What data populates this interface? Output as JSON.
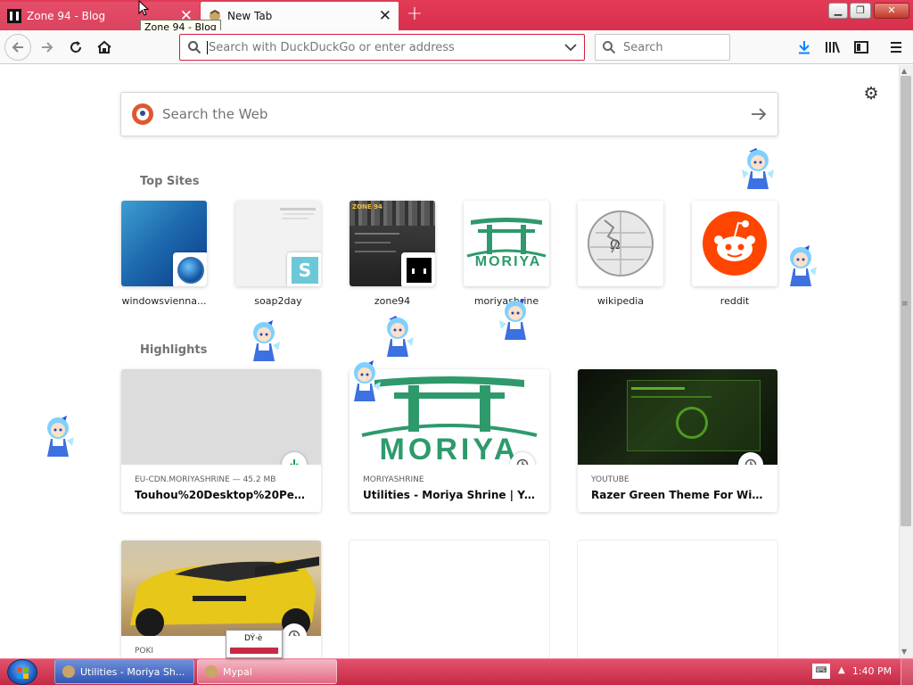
{
  "tabs": [
    {
      "title": "Zone 94 - Blog",
      "active": false
    },
    {
      "title": "New Tab",
      "active": true
    }
  ],
  "tooltip": "Zone 94 - Blog",
  "urlbar": {
    "placeholder": "Search with DuckDuckGo or enter address"
  },
  "searchbar": {
    "placeholder": "Search"
  },
  "newtab_search": {
    "placeholder": "Search the Web"
  },
  "top_sites": {
    "title": "Top Sites",
    "items": [
      {
        "label": "windowsvienna..."
      },
      {
        "label": "soap2day"
      },
      {
        "label": "zone94"
      },
      {
        "label": "moriyashrine"
      },
      {
        "label": "wikipedia"
      },
      {
        "label": "reddit"
      }
    ]
  },
  "highlights": {
    "title": "Highlights",
    "cards": [
      {
        "source": "EU-CDN.MORIYASHRINE — 45.2 MB",
        "title": "Touhou%20Desktop%20Pets.zip",
        "badge": "download-icon"
      },
      {
        "source": "MORIYASHRINE",
        "title": "Utilities - Moriya Shrine | Your r...",
        "badge": "clock-icon",
        "image_text": "MORIYA"
      },
      {
        "source": "YOUTUBE",
        "title": "Razer Green Theme For Windo...",
        "badge": "clock-icon"
      },
      {
        "source": "POKI",
        "title": "",
        "badge": "clock-icon"
      }
    ]
  },
  "site_logo_text": {
    "moriya": "MORIYA",
    "zone94": "ZONE 94",
    "soap2day": "S",
    "wikipedia": "Ω"
  },
  "taskbar": {
    "items": [
      {
        "label": "Utilities - Moriya Sh..."
      },
      {
        "label": "Mypal"
      }
    ],
    "popup_text": "DÝ·è",
    "clock": "1:40 PM"
  },
  "colors": {
    "accent": "#d72f4c",
    "reddit": "#ff4500",
    "moriya_green": "#2e9a6c",
    "ddg": "#de5833"
  }
}
